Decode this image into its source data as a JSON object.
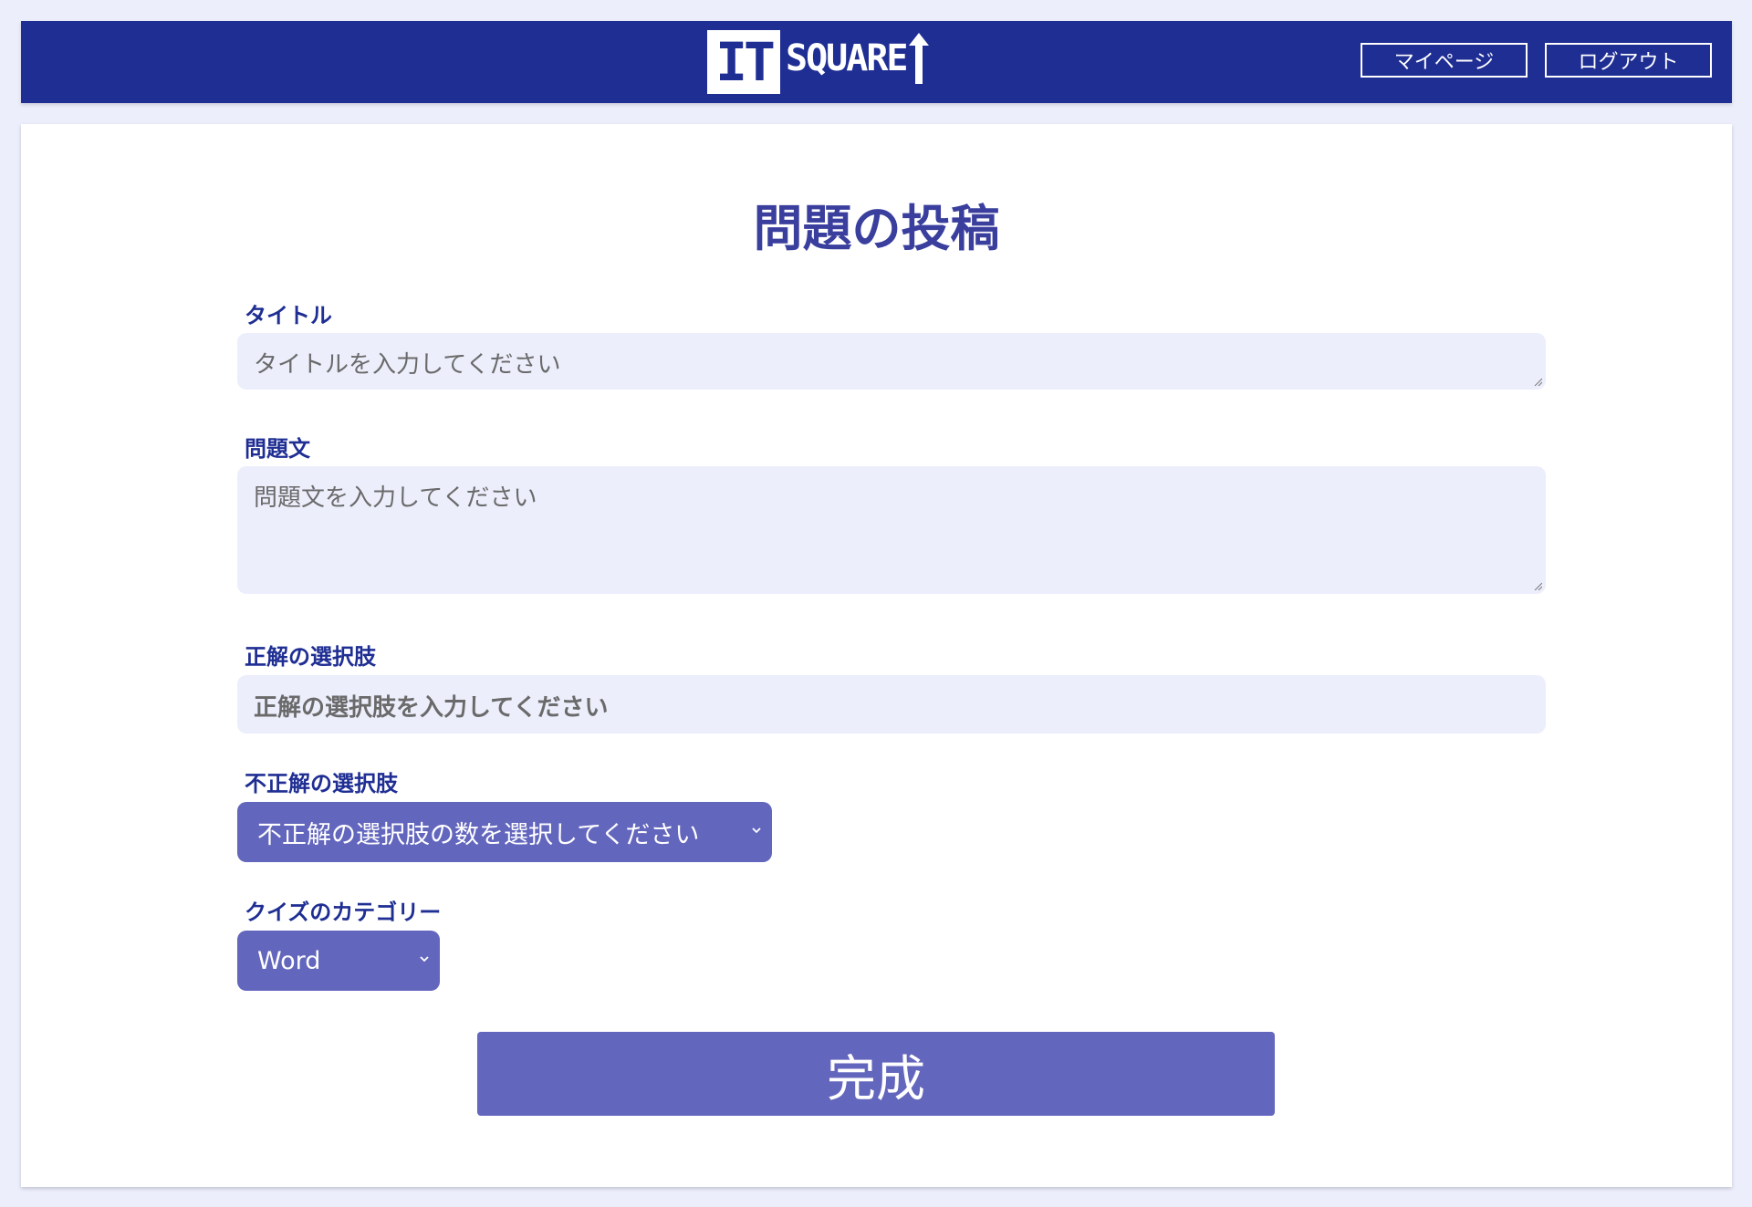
{
  "header": {
    "logo_box_text": "IT",
    "logo_text": "SQUARE",
    "mypage_label": "マイページ",
    "logout_label": "ログアウト"
  },
  "form": {
    "page_title": "問題の投稿",
    "title": {
      "label": "タイトル",
      "placeholder": "タイトルを入力してください"
    },
    "question": {
      "label": "問題文",
      "placeholder": "問題文を入力してください"
    },
    "correct_choice": {
      "label": "正解の選択肢",
      "placeholder": "正解の選択肢を入力してください"
    },
    "incorrect_choices": {
      "label": "不正解の選択肢",
      "selected": "不正解の選択肢の数を選択してください"
    },
    "category": {
      "label": "クイズのカテゴリー",
      "selected": "Word"
    },
    "submit_label": "完成"
  },
  "colors": {
    "page_bg": "#eceefc",
    "header_bg": "#1f2e93",
    "accent": "#6366bd",
    "title_text": "#3a3f9e",
    "label_text": "#1f2e93",
    "field_bg": "#eceefc"
  },
  "icons": [
    "chevron-down-icon",
    "resize-grip-icon",
    "up-arrow-icon"
  ]
}
